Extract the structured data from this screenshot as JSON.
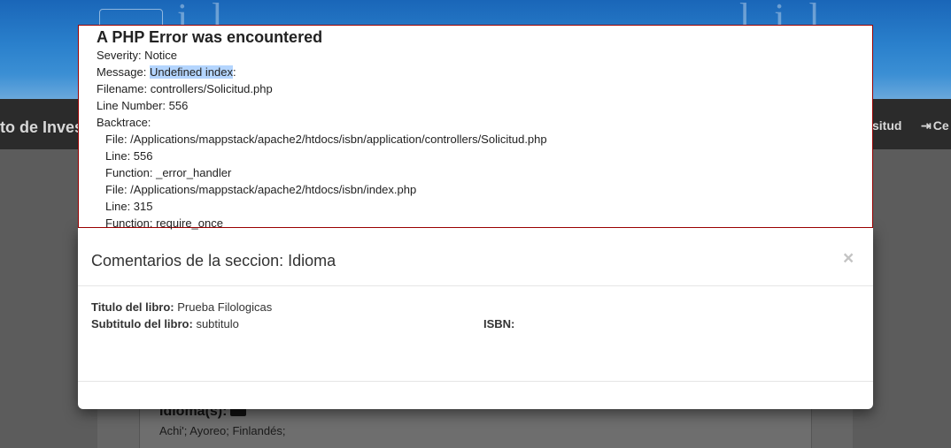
{
  "background": {
    "nav_title": "to de Invest",
    "nav_right_1": "situd",
    "nav_right_2": "Ce",
    "idioma_label": "Idioma(s):",
    "idioma_value": "Achi'; Ayoreo; Finlandés;"
  },
  "php_error": {
    "title": "A PHP Error was encountered",
    "severity": "Severity: Notice",
    "message_prefix": "Message: ",
    "message_highlight": "Undefined index",
    "message_suffix": ":",
    "filename": "Filename: controllers/Solicitud.php",
    "line_number": "Line Number: 556",
    "backtrace_label": "Backtrace:",
    "backtrace": [
      "File: /Applications/mappstack/apache2/htdocs/isbn/application/controllers/Solicitud.php",
      "Line: 556",
      "Function: _error_handler",
      "File: /Applications/mappstack/apache2/htdocs/isbn/index.php",
      "Line: 315",
      "Function: require_once"
    ]
  },
  "modal": {
    "title": "Comentarios de la seccion: Idioma",
    "close_symbol": "×",
    "titulo_label": "Titulo del libro:",
    "titulo_value": " Prueba Filologicas",
    "subtitulo_label": "Subtitulo del libro:",
    "subtitulo_value": " subtitulo",
    "isbn_label": "ISBN:",
    "isbn_value": ""
  },
  "colors": {
    "error_border": "#990000",
    "highlight": "#b4d5fe",
    "header_blue": "#2a80cc",
    "nav_dark": "#2b2b2b"
  }
}
